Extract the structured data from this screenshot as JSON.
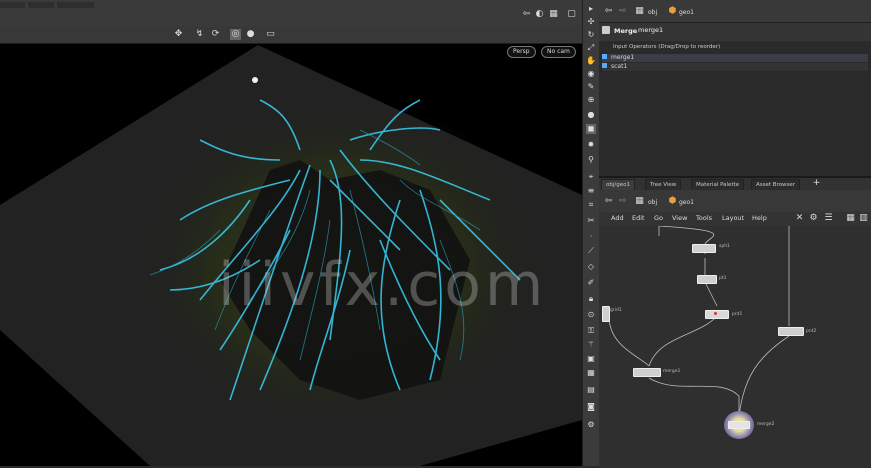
{
  "viewport": {
    "pill_left": "Persp",
    "pill_right": "No cam"
  },
  "params": {
    "path": [
      "obj",
      "geo1"
    ],
    "node_type": "Merge",
    "node_name": "merge1",
    "section_label": "Input Operators (Drag/Drop to reorder)",
    "inputs": [
      "merge1",
      "scat1"
    ]
  },
  "network": {
    "tabs": [
      "obj/geo1",
      "Tree View",
      "Material Palette",
      "Asset Browser"
    ],
    "path": [
      "obj",
      "geo1"
    ],
    "menu": [
      "Add",
      "Edit",
      "Go",
      "View",
      "Tools",
      "Layout",
      "Help"
    ],
    "nodes": [
      "sph1",
      "pt1",
      "pnt1",
      "merge1",
      "pnt2",
      "merge2",
      "grid1"
    ]
  },
  "watermark": "iiivfx.com",
  "colors": {
    "accent": "#38c6e8",
    "background": "#000000"
  }
}
